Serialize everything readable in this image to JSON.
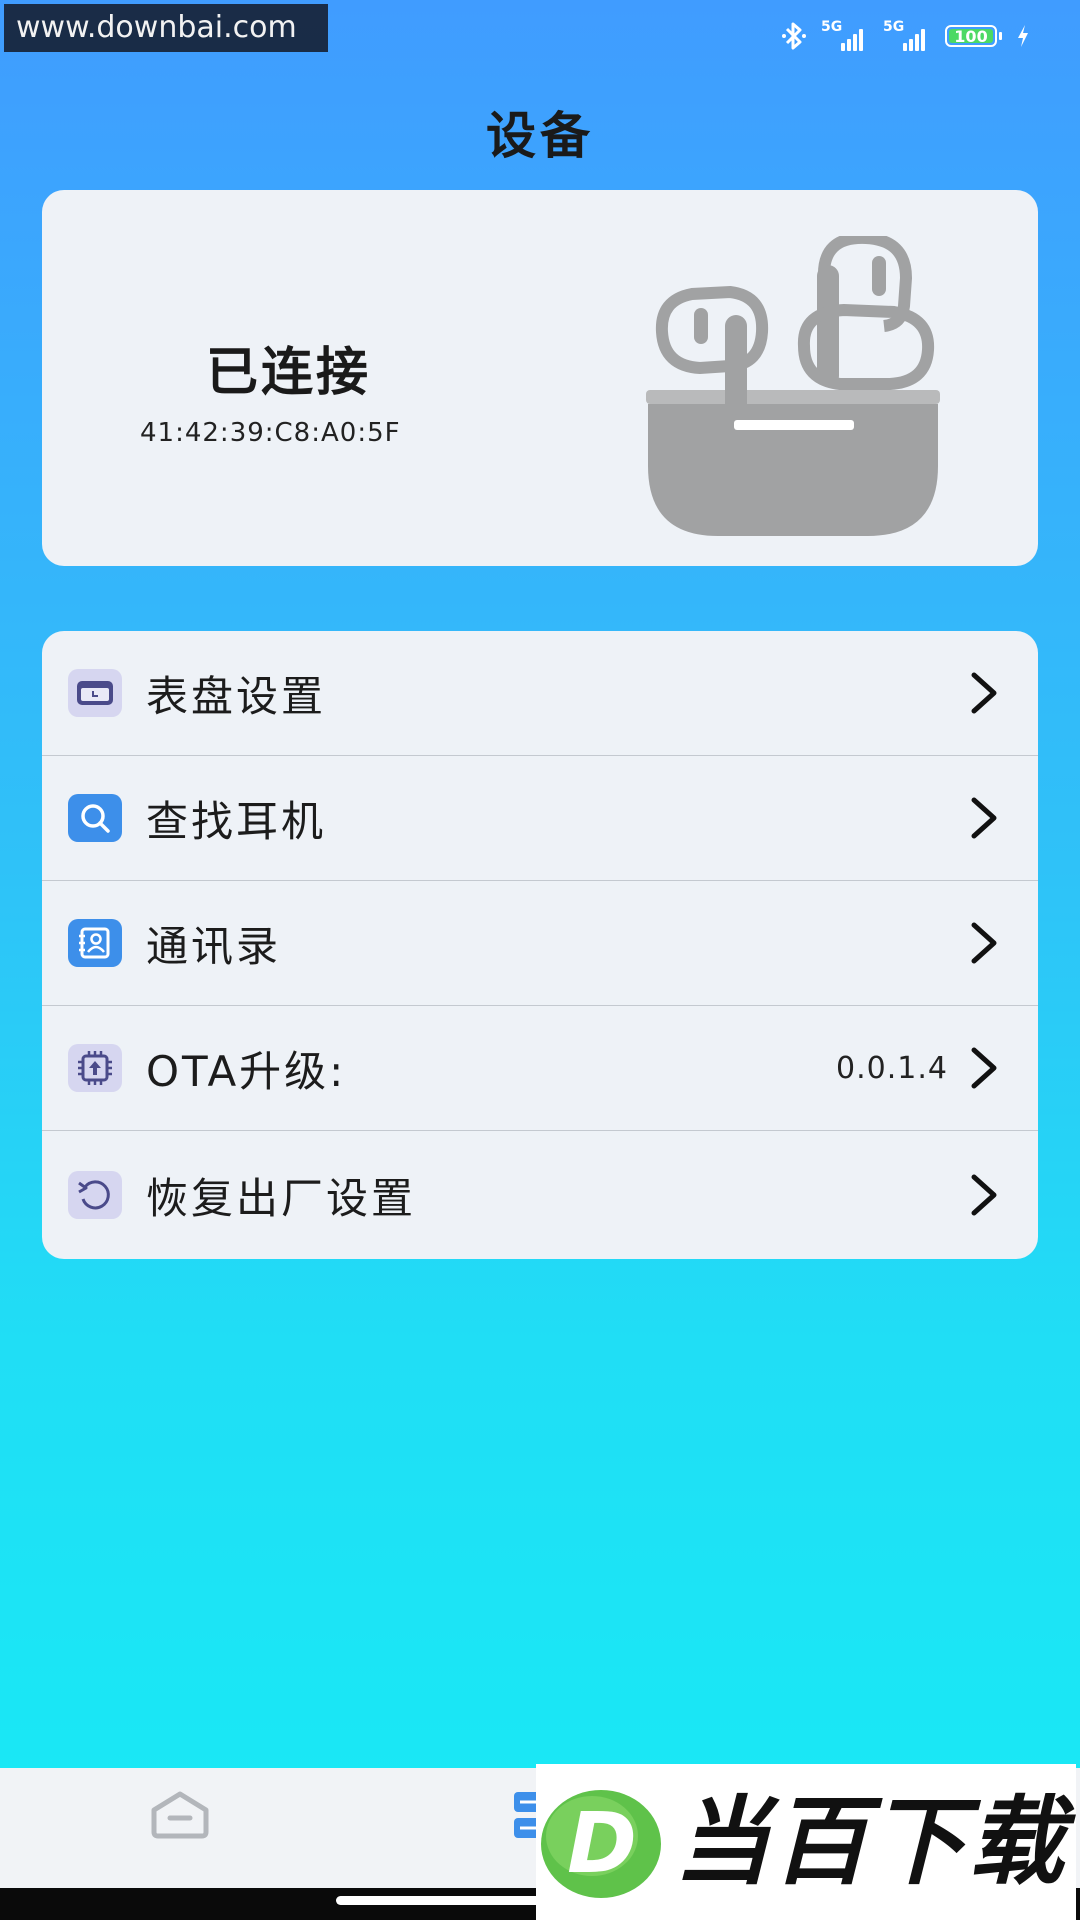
{
  "watermark": {
    "site": "www.downbai.com",
    "brand": "当百下载",
    "brand_logo_letter": "D"
  },
  "status_bar": {
    "network_1": "5G",
    "network_2": "5G",
    "battery": "100",
    "icons": [
      "bluetooth-icon",
      "signal-icon",
      "signal-icon",
      "battery-icon",
      "charging-icon"
    ]
  },
  "page": {
    "title": "设备"
  },
  "device": {
    "status": "已连接",
    "mac": "41:42:39:C8:A0:5F",
    "image": "earbuds-case-illustration"
  },
  "menu": {
    "items": [
      {
        "label": "表盘设置",
        "value": "",
        "icon": "watch-face-icon"
      },
      {
        "label": "查找耳机",
        "value": "",
        "icon": "search-icon"
      },
      {
        "label": "通讯录",
        "value": "",
        "icon": "contacts-icon"
      },
      {
        "label": "OTA升级:",
        "value": "0.0.1.4",
        "icon": "chip-upgrade-icon"
      },
      {
        "label": "恢复出厂设置",
        "value": "",
        "icon": "reset-icon"
      }
    ]
  },
  "bottom_nav": {
    "items": [
      {
        "icon": "home-icon"
      },
      {
        "icon": "device-list-icon"
      }
    ]
  },
  "colors": {
    "gradient_top": "#409cff",
    "gradient_bottom": "#17ebf5",
    "card_bg": "#eef2f7",
    "icon_blue": "#3d8fea",
    "icon_purple": "#5b5bb5"
  }
}
